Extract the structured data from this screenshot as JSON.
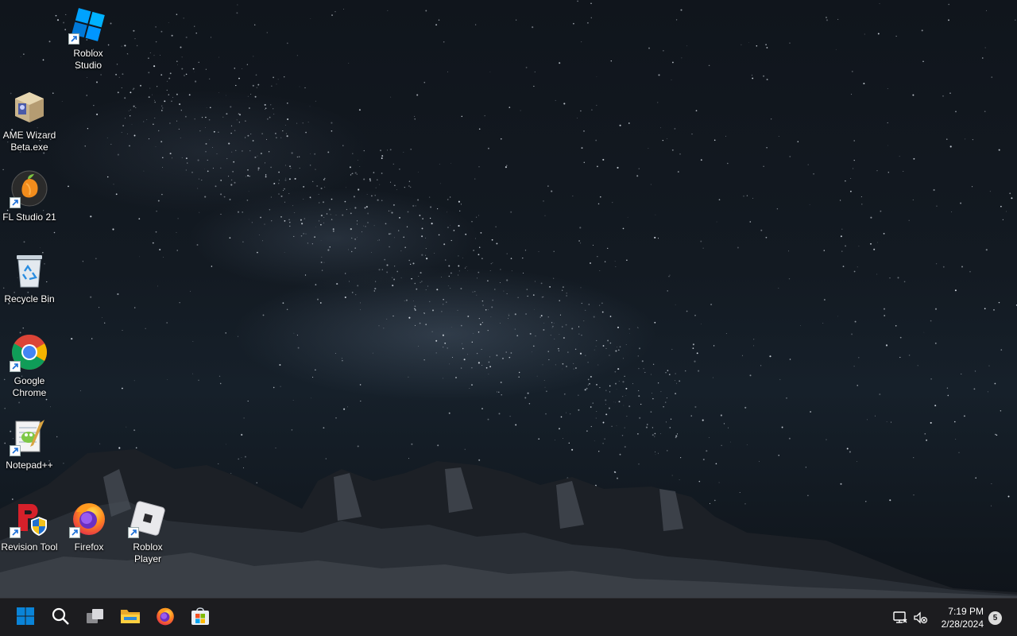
{
  "desktop": {
    "icons": [
      {
        "name": "roblox-studio",
        "label": "Roblox\nStudio",
        "icon": "roblox-studio-icon",
        "shortcut": true
      },
      {
        "name": "ame-wizard",
        "label": "AME Wizard\nBeta.exe",
        "icon": "ame-wizard-icon",
        "shortcut": false
      },
      {
        "name": "fl-studio",
        "label": "FL Studio 21",
        "icon": "fl-studio-icon",
        "shortcut": true
      },
      {
        "name": "recycle-bin",
        "label": "Recycle Bin",
        "icon": "recycle-bin-icon",
        "shortcut": false
      },
      {
        "name": "google-chrome",
        "label": "Google\nChrome",
        "icon": "chrome-icon",
        "shortcut": true
      },
      {
        "name": "notepad-plus-plus",
        "label": "Notepad++",
        "icon": "notepad-plus-plus-icon",
        "shortcut": true
      },
      {
        "name": "revision-tool",
        "label": "Revision Tool",
        "icon": "revision-tool-icon",
        "shortcut": true
      },
      {
        "name": "firefox",
        "label": "Firefox",
        "icon": "firefox-icon",
        "shortcut": true
      },
      {
        "name": "roblox-player",
        "label": "Roblox\nPlayer",
        "icon": "roblox-player-icon",
        "shortcut": true
      }
    ]
  },
  "taskbar": {
    "apps": [
      {
        "name": "start-button",
        "icon": "windows-logo-icon"
      },
      {
        "name": "search-button",
        "icon": "search-icon"
      },
      {
        "name": "task-view-button",
        "icon": "task-view-icon"
      },
      {
        "name": "file-explorer-button",
        "icon": "folder-icon"
      },
      {
        "name": "firefox-taskbar-button",
        "icon": "firefox-icon"
      },
      {
        "name": "microsoft-store-button",
        "icon": "store-icon"
      }
    ],
    "tray": {
      "network_icon": "network-disconnected-icon",
      "volume_icon": "volume-muted-icon",
      "time": "7:19 PM",
      "date": "2/28/2024",
      "notification_count": "5"
    }
  },
  "colors": {
    "taskbar_bg": "#1c1c1f",
    "label_text": "#ffffff",
    "windows_blue": "#0a84d8"
  }
}
